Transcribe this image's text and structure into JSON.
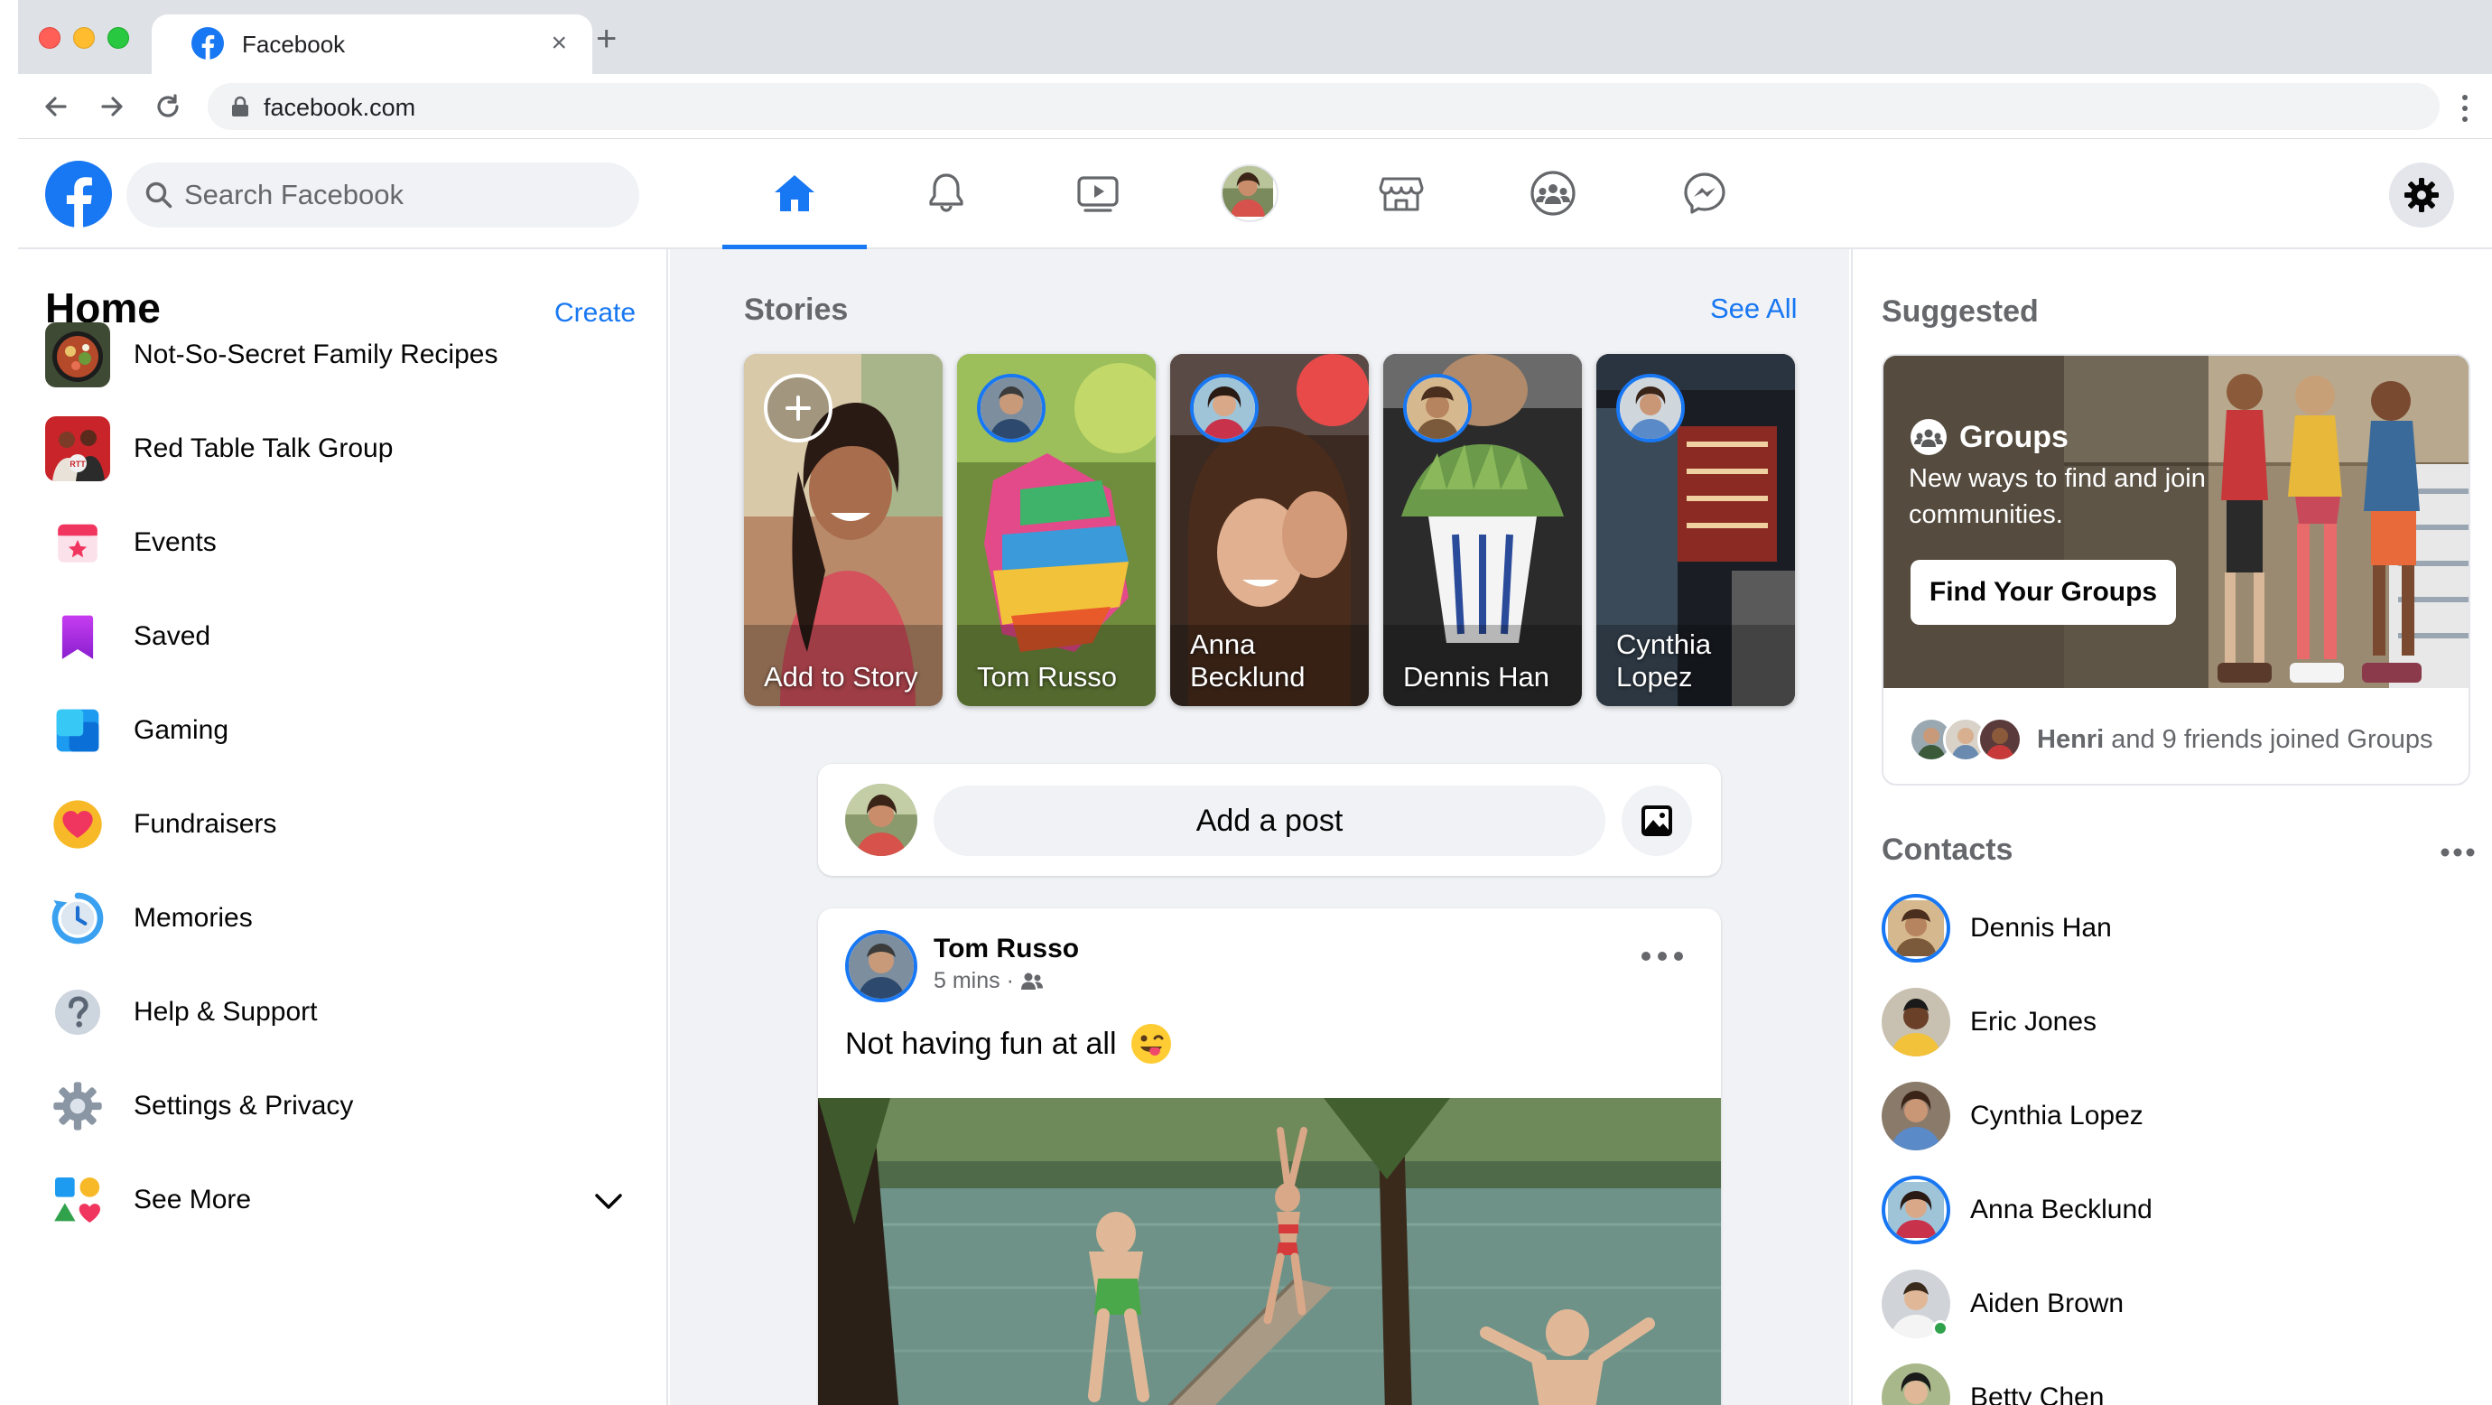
{
  "browser": {
    "tab_title": "Facebook",
    "url": "facebook.com"
  },
  "header": {
    "search_placeholder": "Search Facebook",
    "nav_tabs": [
      "home",
      "notifications",
      "watch",
      "profile",
      "marketplace",
      "groups",
      "messenger"
    ],
    "active_tab": "home"
  },
  "sidebar": {
    "title": "Home",
    "create_label": "Create",
    "items": [
      {
        "label": "Not-So-Secret Family Recipes",
        "icon": "recipes-group-thumbnail"
      },
      {
        "label": "Red Table Talk Group",
        "icon": "red-table-talk-thumbnail"
      },
      {
        "label": "Events",
        "icon": "calendar-icon"
      },
      {
        "label": "Saved",
        "icon": "bookmark-icon"
      },
      {
        "label": "Gaming",
        "icon": "gaming-icon"
      },
      {
        "label": "Fundraisers",
        "icon": "heart-icon"
      },
      {
        "label": "Memories",
        "icon": "clock-icon"
      },
      {
        "label": "Help & Support",
        "icon": "question-icon"
      },
      {
        "label": "Settings & Privacy",
        "icon": "gear-icon"
      },
      {
        "label": "See More",
        "icon": "shapes-icon"
      }
    ]
  },
  "stories": {
    "title": "Stories",
    "see_all_label": "See All",
    "items": [
      {
        "label": "Add to Story"
      },
      {
        "label": "Tom Russo"
      },
      {
        "label": "Anna Becklund"
      },
      {
        "label": "Dennis Han"
      },
      {
        "label": "Cynthia Lopez"
      }
    ]
  },
  "composer": {
    "placeholder": "Add a post"
  },
  "post": {
    "author": "Tom Russo",
    "time": "5 mins",
    "text": "Not having fun at all",
    "emoji": "winking-face-with-tongue"
  },
  "suggested": {
    "title": "Suggested",
    "card_title": "Groups",
    "card_desc": "New ways to find and join communities.",
    "button_label": "Find Your Groups",
    "footer_name": "Henri",
    "footer_rest": " and 9 friends joined Groups"
  },
  "contacts": {
    "title": "Contacts",
    "items": [
      {
        "name": "Dennis Han",
        "story_ring": true,
        "online": false
      },
      {
        "name": "Eric Jones",
        "story_ring": false,
        "online": false
      },
      {
        "name": "Cynthia Lopez",
        "story_ring": false,
        "online": false
      },
      {
        "name": "Anna Becklund",
        "story_ring": true,
        "online": false
      },
      {
        "name": "Aiden Brown",
        "story_ring": false,
        "online": true
      },
      {
        "name": "Betty Chen",
        "story_ring": false,
        "online": false
      }
    ]
  },
  "colors": {
    "brand_blue": "#1877f2",
    "secondary_text": "#65676b",
    "feed_bg": "#f0f2f5",
    "online_green": "#31a24c"
  }
}
